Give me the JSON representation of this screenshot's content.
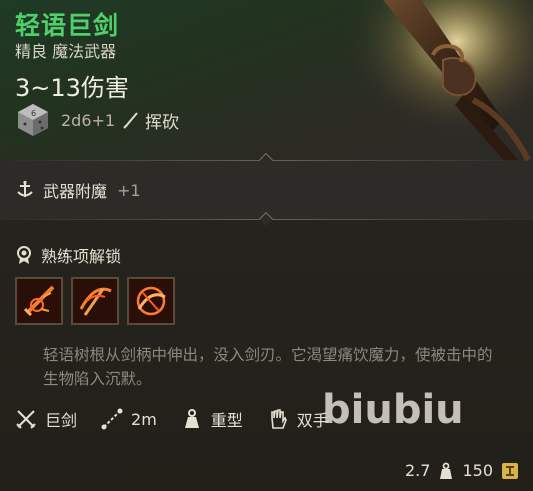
{
  "item": {
    "name": "轻语巨剑",
    "subtitle": "精良 魔法武器",
    "damage": "3~13伤害",
    "dice": "2d6+1",
    "damage_type": "挥砍",
    "name_color": "#4fd06a"
  },
  "enchant": {
    "label": "武器附魔",
    "value": "+1"
  },
  "proficiency": {
    "label": "熟练项解锁",
    "skills": [
      "skill-1-icon",
      "skill-2-icon",
      "skill-3-icon"
    ]
  },
  "description": "轻语树根从剑柄中伸出，没入剑刃。它渴望痛饮魔力，使被击中的生物陷入沉默。",
  "traits": [
    {
      "label": "巨剑",
      "icon": "crossed-swords-icon"
    },
    {
      "label": "2m",
      "icon": "range-icon"
    },
    {
      "label": "重型",
      "icon": "heavy-weight-icon"
    },
    {
      "label": "双手",
      "icon": "two-hands-icon"
    }
  ],
  "watermark": "biubiu",
  "footer": {
    "weight": "2.7",
    "price": "150"
  }
}
